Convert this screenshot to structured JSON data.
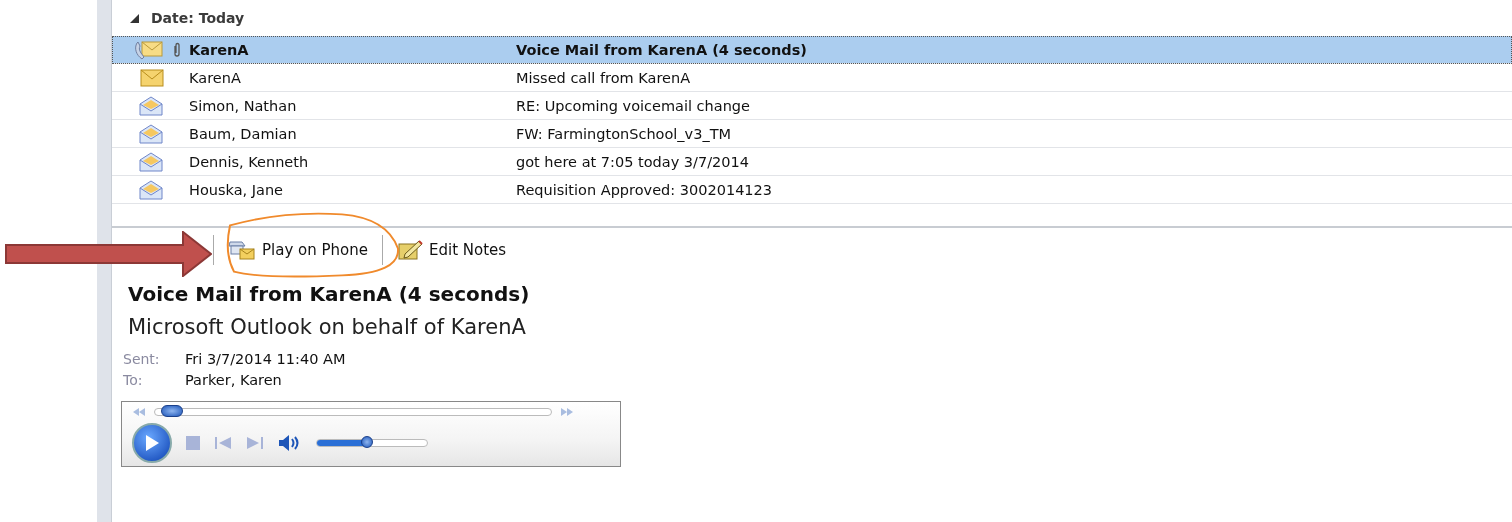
{
  "group": {
    "label": "Date: Today",
    "expanded": true
  },
  "messages": [
    {
      "kind": "voicemail",
      "attachment": true,
      "unread": true,
      "selected": true,
      "sender": "KarenA",
      "subject": "Voice Mail from KarenA (4 seconds)"
    },
    {
      "kind": "missed",
      "attachment": false,
      "unread": false,
      "selected": false,
      "sender": "KarenA",
      "subject": "Missed call from KarenA"
    },
    {
      "kind": "read",
      "attachment": false,
      "unread": false,
      "selected": false,
      "sender": "Simon, Nathan",
      "subject": "RE: Upcoming voicemail change"
    },
    {
      "kind": "read",
      "attachment": false,
      "unread": false,
      "selected": false,
      "sender": "Baum, Damian",
      "subject": "FW: FarmingtonSchool_v3_TM"
    },
    {
      "kind": "read",
      "attachment": false,
      "unread": false,
      "selected": false,
      "sender": "Dennis, Kenneth",
      "subject": "got here at 7:05 today 3/7/2014"
    },
    {
      "kind": "read",
      "attachment": false,
      "unread": false,
      "selected": false,
      "sender": "Houska, Jane",
      "subject": "Requisition Approved: 3002014123"
    }
  ],
  "toolbar": [
    {
      "kind": "play-phone",
      "label": "Play on Phone"
    },
    {
      "kind": "edit-notes",
      "label": "Edit Notes"
    }
  ],
  "reading": {
    "title": "Voice Mail from KarenA (4 seconds)",
    "from": "Microsoft Outlook on behalf of KarenA",
    "fields": [
      {
        "label": "Sent:",
        "value": "Fri 3/7/2014 11:40 AM"
      },
      {
        "label": "To:",
        "value": "Parker, Karen"
      }
    ]
  },
  "player": {
    "seek": {
      "level": 0.02
    },
    "volume": {
      "level": 0.45
    }
  }
}
